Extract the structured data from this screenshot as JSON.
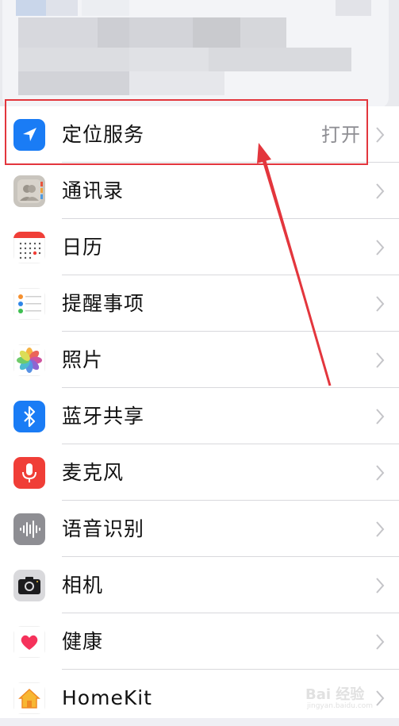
{
  "settings": {
    "items": [
      {
        "label": "定位服务",
        "value": "打开",
        "icon": "location-arrow-icon"
      },
      {
        "label": "通讯录",
        "icon": "contacts-icon"
      },
      {
        "label": "日历",
        "icon": "calendar-icon"
      },
      {
        "label": "提醒事项",
        "icon": "reminders-icon"
      },
      {
        "label": "照片",
        "icon": "photos-icon"
      },
      {
        "label": "蓝牙共享",
        "icon": "bluetooth-icon"
      },
      {
        "label": "麦克风",
        "icon": "microphone-icon"
      },
      {
        "label": "语音识别",
        "icon": "speech-recognition-icon"
      },
      {
        "label": "相机",
        "icon": "camera-icon"
      },
      {
        "label": "健康",
        "icon": "health-heart-icon"
      },
      {
        "label": "HomeKit",
        "icon": "homekit-house-icon"
      }
    ]
  },
  "annotation": {
    "color": "#e3363d"
  },
  "colors": {
    "ios_blue": "#1a7cf5",
    "ios_red": "#f03e37"
  }
}
